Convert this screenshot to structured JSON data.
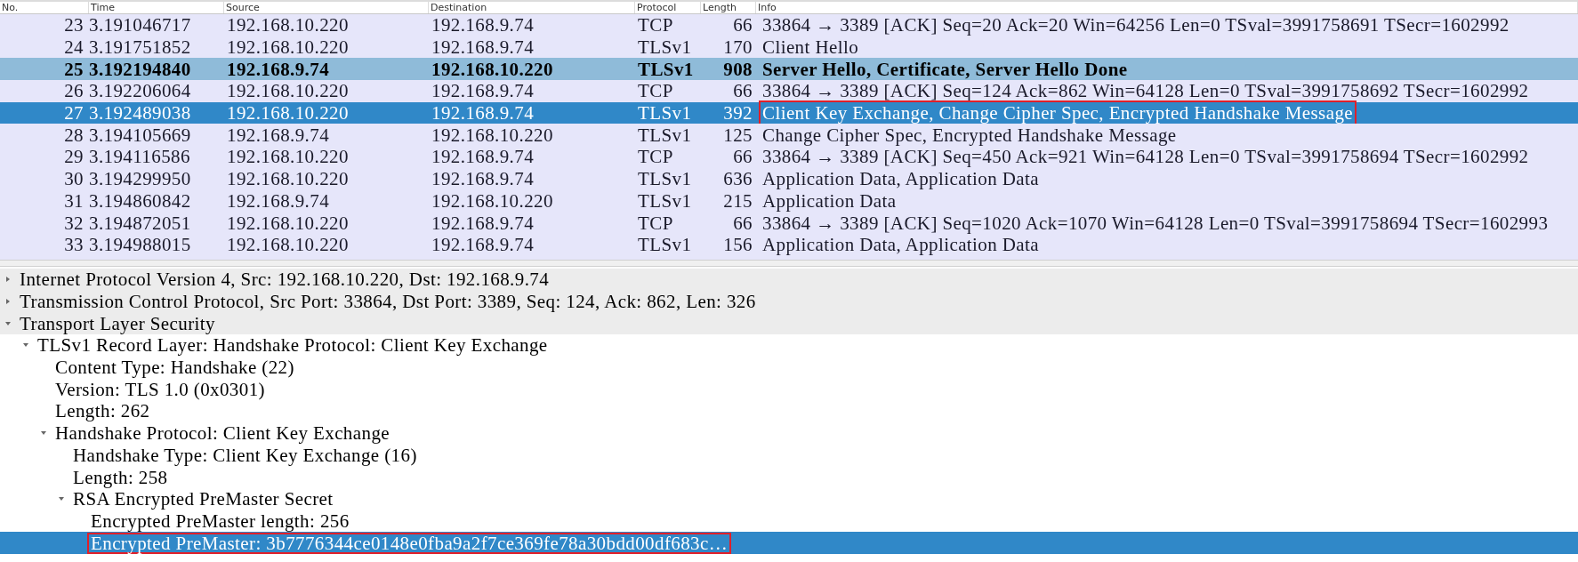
{
  "packet_list": {
    "columns": [
      "No.",
      "Time",
      "Source",
      "Destination",
      "Protocol",
      "Length",
      "Info"
    ],
    "rows": [
      {
        "no": "23",
        "time": "3.191046717",
        "source": "192.168.10.220",
        "destination": "192.168.9.74",
        "protocol": "TCP",
        "length": "66",
        "info": "33864 → 3389 [ACK] Seq=20 Ack=20 Win=64256 Len=0 TSval=3991758691 TSecr=1602992",
        "selected": false,
        "related": false,
        "annotated": false
      },
      {
        "no": "24",
        "time": "3.191751852",
        "source": "192.168.10.220",
        "destination": "192.168.9.74",
        "protocol": "TLSv1",
        "length": "170",
        "info": "Client Hello",
        "selected": false,
        "related": false,
        "annotated": false
      },
      {
        "no": "25",
        "time": "3.192194840",
        "source": "192.168.9.74",
        "destination": "192.168.10.220",
        "protocol": "TLSv1",
        "length": "908",
        "info": "Server Hello, Certificate, Server Hello Done",
        "selected": false,
        "related": true,
        "annotated": false
      },
      {
        "no": "26",
        "time": "3.192206064",
        "source": "192.168.10.220",
        "destination": "192.168.9.74",
        "protocol": "TCP",
        "length": "66",
        "info": "33864 → 3389 [ACK] Seq=124 Ack=862 Win=64128 Len=0 TSval=3991758692 TSecr=1602992",
        "selected": false,
        "related": false,
        "annotated": false
      },
      {
        "no": "27",
        "time": "3.192489038",
        "source": "192.168.10.220",
        "destination": "192.168.9.74",
        "protocol": "TLSv1",
        "length": "392",
        "info": "Client Key Exchange, Change Cipher Spec, Encrypted Handshake Message",
        "selected": true,
        "related": false,
        "annotated": true
      },
      {
        "no": "28",
        "time": "3.194105669",
        "source": "192.168.9.74",
        "destination": "192.168.10.220",
        "protocol": "TLSv1",
        "length": "125",
        "info": "Change Cipher Spec, Encrypted Handshake Message",
        "selected": false,
        "related": false,
        "annotated": false
      },
      {
        "no": "29",
        "time": "3.194116586",
        "source": "192.168.10.220",
        "destination": "192.168.9.74",
        "protocol": "TCP",
        "length": "66",
        "info": "33864 → 3389 [ACK] Seq=450 Ack=921 Win=64128 Len=0 TSval=3991758694 TSecr=1602992",
        "selected": false,
        "related": false,
        "annotated": false
      },
      {
        "no": "30",
        "time": "3.194299950",
        "source": "192.168.10.220",
        "destination": "192.168.9.74",
        "protocol": "TLSv1",
        "length": "636",
        "info": "Application Data, Application Data",
        "selected": false,
        "related": false,
        "annotated": false
      },
      {
        "no": "31",
        "time": "3.194860842",
        "source": "192.168.9.74",
        "destination": "192.168.10.220",
        "protocol": "TLSv1",
        "length": "215",
        "info": "Application Data",
        "selected": false,
        "related": false,
        "annotated": false
      },
      {
        "no": "32",
        "time": "3.194872051",
        "source": "192.168.10.220",
        "destination": "192.168.9.74",
        "protocol": "TCP",
        "length": "66",
        "info": "33864 → 3389 [ACK] Seq=1020 Ack=1070 Win=64128 Len=0 TSval=3991758694 TSecr=1602993",
        "selected": false,
        "related": false,
        "annotated": false
      },
      {
        "no": "33",
        "time": "3.194988015",
        "source": "192.168.10.220",
        "destination": "192.168.9.74",
        "protocol": "TLSv1",
        "length": "156",
        "info": "Application Data, Application Data",
        "selected": false,
        "related": false,
        "annotated": false
      }
    ]
  },
  "packet_details": [
    {
      "label": "Internet Protocol Version 4, Src: 192.168.10.220, Dst: 192.168.9.74",
      "expanded": false,
      "selected": false,
      "annotated": false
    },
    {
      "label": "Transmission Control Protocol, Src Port: 33864, Dst Port: 3389, Seq: 124, Ack: 862, Len: 326",
      "expanded": false,
      "selected": false,
      "annotated": false
    },
    {
      "label": "Transport Layer Security",
      "expanded": true,
      "selected": false,
      "annotated": false,
      "children": [
        {
          "label": "TLSv1 Record Layer: Handshake Protocol: Client Key Exchange",
          "expanded": true,
          "selected": false,
          "annotated": false,
          "children": [
            {
              "label": "Content Type: Handshake (22)",
              "selected": false,
              "annotated": false
            },
            {
              "label": "Version: TLS 1.0 (0x0301)",
              "selected": false,
              "annotated": false
            },
            {
              "label": "Length: 262",
              "selected": false,
              "annotated": false
            },
            {
              "label": "Handshake Protocol: Client Key Exchange",
              "expanded": true,
              "selected": false,
              "annotated": false,
              "children": [
                {
                  "label": "Handshake Type: Client Key Exchange (16)",
                  "selected": false,
                  "annotated": false
                },
                {
                  "label": "Length: 258",
                  "selected": false,
                  "annotated": false
                },
                {
                  "label": "RSA Encrypted PreMaster Secret",
                  "expanded": true,
                  "selected": false,
                  "annotated": false,
                  "children": [
                    {
                      "label": "Encrypted PreMaster length: 256",
                      "selected": false,
                      "annotated": false
                    },
                    {
                      "label": "Encrypted PreMaster: 3b7776344ce0148e0fba9a2f7ce369fe78a30bdd00df683c…",
                      "selected": true,
                      "annotated": true
                    }
                  ]
                }
              ]
            }
          ]
        }
      ]
    }
  ]
}
